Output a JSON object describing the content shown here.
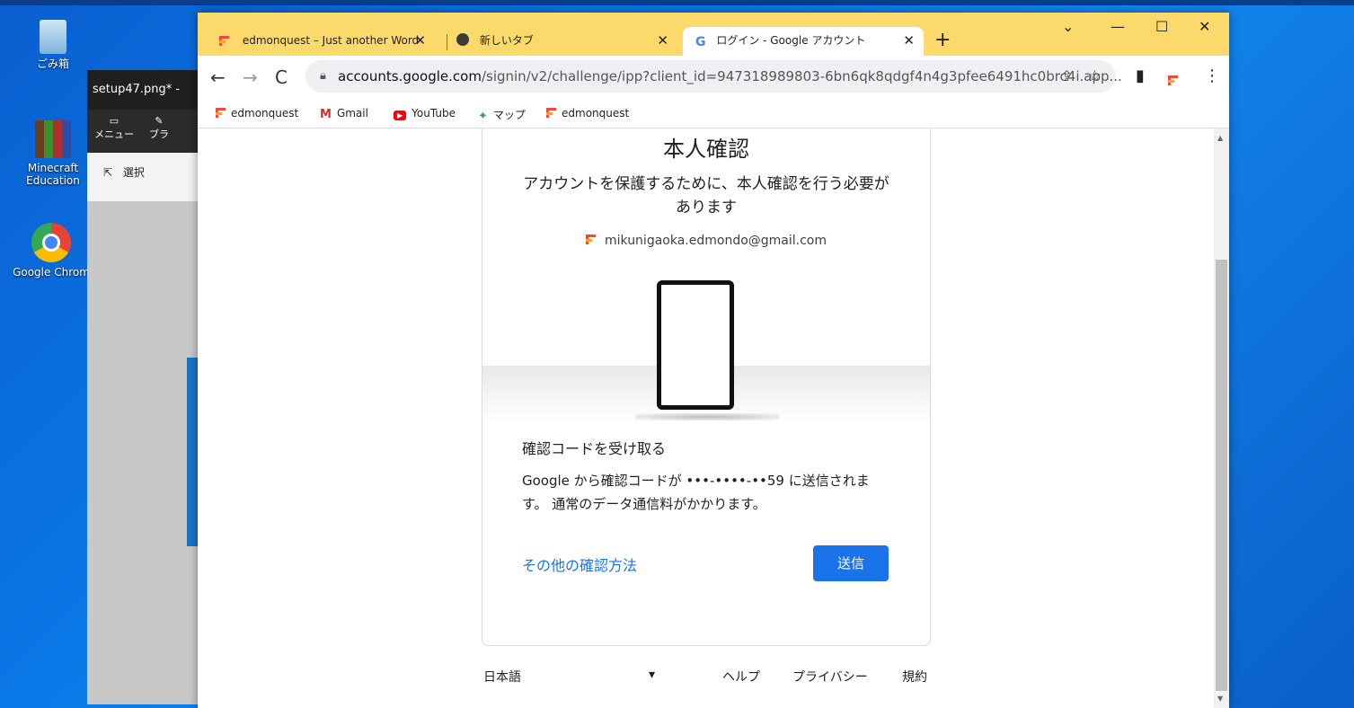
{
  "desktop": {
    "icons": [
      {
        "name": "recycle-bin",
        "label": "ごみ箱"
      },
      {
        "name": "minecraft",
        "label": "Minecraft Education"
      },
      {
        "name": "chrome",
        "label": "Google Chrom"
      }
    ]
  },
  "paint": {
    "title": "setup47.png* -",
    "menu_label": "メニュー",
    "brush_label": "ブラ",
    "select_label": "選択"
  },
  "browser": {
    "tabs": [
      {
        "label": "edmonquest – Just another Word"
      },
      {
        "label": "新しいタブ"
      },
      {
        "label": "ログイン - Google アカウント"
      }
    ],
    "url_host": "accounts.google.com",
    "url_path": "/signin/v2/challenge/ipp?client_id=947318989803-6bn6qk8qdgf4n4g3pfee6491hc0brc4i.app...",
    "bookmarks": [
      "edmonquest",
      "Gmail",
      "YouTube",
      "マップ",
      "edmonquest"
    ]
  },
  "page": {
    "title": "本人確認",
    "subtitle": "アカウントを保護するために、本人確認を行う必要があります",
    "email": "mikunigaoka.edmondo@gmail.com",
    "section_title": "確認コードを受け取る",
    "section_body": "Google から確認コードが •••-••••-••59 に送信されます。 通常のデータ通信料がかかります。",
    "other_method": "その他の確認方法",
    "send_button": "送信",
    "language": "日本語",
    "help": "ヘルプ",
    "privacy": "プライバシー",
    "terms": "規約"
  }
}
